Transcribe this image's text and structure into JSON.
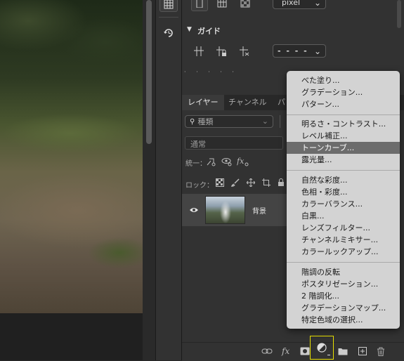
{
  "toolbar_top": {
    "pixel_select": "pixel",
    "chevron": "⌄"
  },
  "guides": {
    "title": "ガイド",
    "line_style": "- - - -"
  },
  "layers_panel": {
    "tabs": [
      "レイヤー",
      "チャンネル",
      "パ"
    ],
    "search_placeholder": "種類",
    "blend_mode": "通常",
    "unify_label": "統一：",
    "lock_label": "ロック：",
    "layer_name": "背景"
  },
  "adjustment_menu": {
    "group1": [
      "べた塗り...",
      "グラデーション...",
      "パターン..."
    ],
    "group2": [
      "明るさ・コントラスト...",
      "レベル補正...",
      "トーンカーブ...",
      "露光量..."
    ],
    "group3": [
      "自然な彩度...",
      "色相・彩度...",
      "カラーバランス...",
      "白黒...",
      "レンズフィルター...",
      "チャンネルミキサー...",
      "カラールックアップ..."
    ],
    "group4": [
      "階調の反転",
      "ポスタリゼーション...",
      "2 階調化...",
      "グラデーションマップ...",
      "特定色域の選択..."
    ],
    "highlighted": "トーンカーブ..."
  },
  "colors": {
    "panel_bg": "#323232",
    "menu_bg": "#d3d3d3",
    "menu_highlight": "#6c6c6c",
    "adjustment_button_outline": "#e8e000"
  }
}
